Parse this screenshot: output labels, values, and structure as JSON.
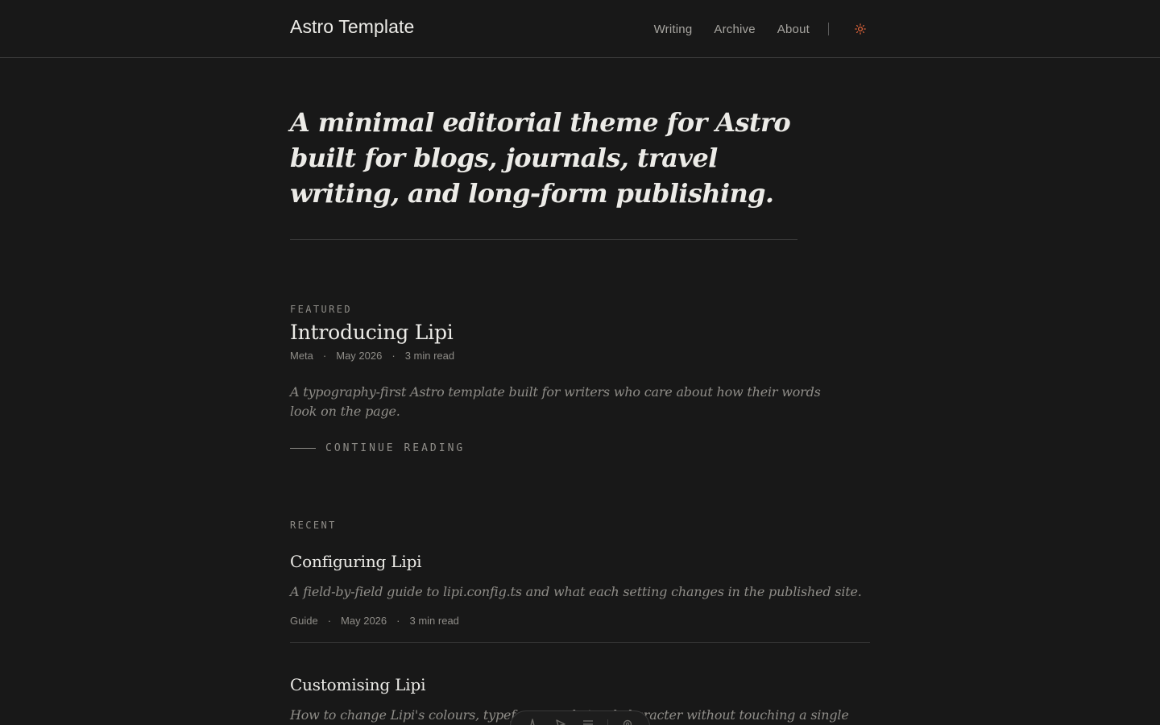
{
  "header": {
    "site_title": "Astro Template",
    "nav": [
      {
        "label": "Writing"
      },
      {
        "label": "Archive"
      },
      {
        "label": "About"
      }
    ],
    "theme_toggle_icon": "sun-icon",
    "accent_color": "#e0643a"
  },
  "hero": {
    "text": "A minimal editorial theme for Astro built for blogs, journals, travel writing, and long-form publishing."
  },
  "featured": {
    "eyebrow": "FEATURED",
    "title": "Introducing Lipi",
    "category": "Meta",
    "date": "May 2026",
    "read_time": "3 min read",
    "separator": "·",
    "excerpt": "A typography-first Astro template built for writers who care about how their words look on the page.",
    "cta": "CONTINUE READING"
  },
  "recent": {
    "eyebrow": "RECENT",
    "posts": [
      {
        "title": "Configuring Lipi",
        "excerpt": "A field-by-field guide to lipi.config.ts and what each setting changes in the published site.",
        "category": "Guide",
        "date": "May 2026",
        "read_time": "3 min read"
      },
      {
        "title": "Customising Lipi",
        "excerpt": "How to change Lipi's colours, typefaces, and visual character without touching a single"
      }
    ]
  },
  "toolbar": {
    "icons": [
      "astro-icon",
      "pointer-icon",
      "menu-icon",
      "settings-icon"
    ]
  }
}
